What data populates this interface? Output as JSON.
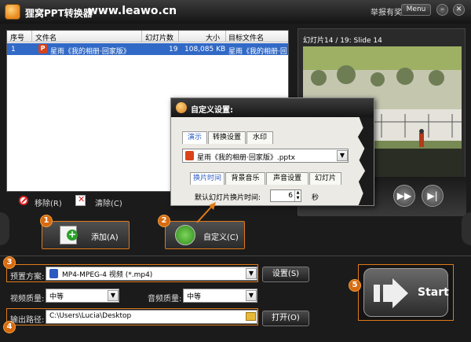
{
  "app": {
    "title": "狸窝PPT转换器",
    "url": "www.leawo.cn",
    "report_label": "举报有奖",
    "menu_label": "Menu",
    "minimize_symbol": "–",
    "close_symbol": "✕"
  },
  "file_list": {
    "columns": [
      "序号",
      "文件名",
      "幻灯片数",
      "大小",
      "目标文件名"
    ],
    "rows": [
      {
        "index": "1",
        "name": "星雨《我的相册·回家版》",
        "slides": "19",
        "size": "108,085 KB",
        "target": "星雨《我的相册·回家"
      }
    ]
  },
  "list_actions": {
    "remove_label": "移除(R)",
    "clear_label": "清除(C)"
  },
  "preview": {
    "label": "幻灯片14 / 19: Slide 14",
    "forward_symbol": "▶▶",
    "next_symbol": "▶|"
  },
  "dialog": {
    "title": "自定义设置:",
    "top_tabs": [
      "演示",
      "转换设置",
      "水印"
    ],
    "file_select_value": "星雨《我的相册·回家版》.pptx",
    "sub_tabs": [
      "换片时间",
      "背景音乐",
      "声音设置",
      "幻灯片"
    ],
    "interval_label": "默认幻灯片换片时间:",
    "interval_value": "6",
    "interval_unit": "秒"
  },
  "actions": {
    "add_label": "添加(A)",
    "custom_label": "自定义(C)",
    "start_label": "Start"
  },
  "markers": [
    "1",
    "2",
    "3",
    "4",
    "5"
  ],
  "output": {
    "preset_label": "预置方案:",
    "preset_value": "MP4-MPEG-4 视频 (*.mp4)",
    "settings_button": "设置(S)",
    "video_quality_label": "视频质量:",
    "video_quality_value": "中等",
    "audio_quality_label": "音频质量:",
    "audio_quality_value": "中等",
    "output_path_label": "输出路径:",
    "output_path_value": "C:\\Users\\Lucia\\Desktop",
    "open_button": "打开(O)"
  },
  "colors": {
    "accent": "#e07a1a",
    "selection": "#3169c6",
    "background": "#1b1b1b"
  }
}
